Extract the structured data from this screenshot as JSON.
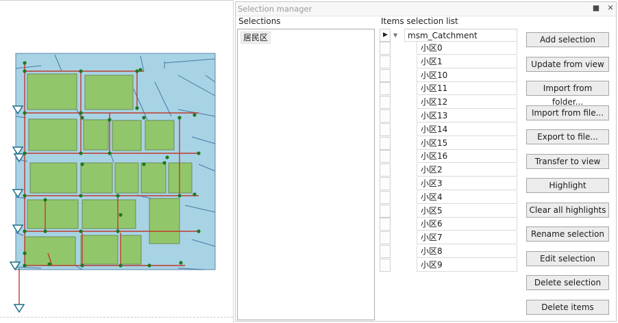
{
  "panel": {
    "title": "Selection manager",
    "pin_icon": "pin-icon",
    "close_icon": "close-icon",
    "pin_glyph": "■",
    "close_glyph": "✕"
  },
  "selections": {
    "label": "Selections",
    "items": [
      "居民区"
    ]
  },
  "items_list": {
    "label": "Items selection list",
    "root": "msm_Catchment",
    "children": [
      "小区0",
      "小区1",
      "小区10",
      "小区11",
      "小区12",
      "小区13",
      "小区14",
      "小区15",
      "小区16",
      "小区2",
      "小区3",
      "小区4",
      "小区5",
      "小区6",
      "小区7",
      "小区8",
      "小区9"
    ]
  },
  "buttons": [
    "Add selection",
    "Update from view",
    "Import from folder...",
    "Import from file...",
    "Export to file...",
    "Transfer to view",
    "Highlight",
    "Clear all highlights",
    "Rename selection",
    "Edit selection",
    "Delete selection",
    "Delete items"
  ],
  "map": {
    "water_color": "#a7d3e4",
    "catchment_fill": "#92c66a",
    "pipe_color": "#c0392b",
    "node_color": "#1b7a1b",
    "outlet_color": "#1c6f8a"
  }
}
